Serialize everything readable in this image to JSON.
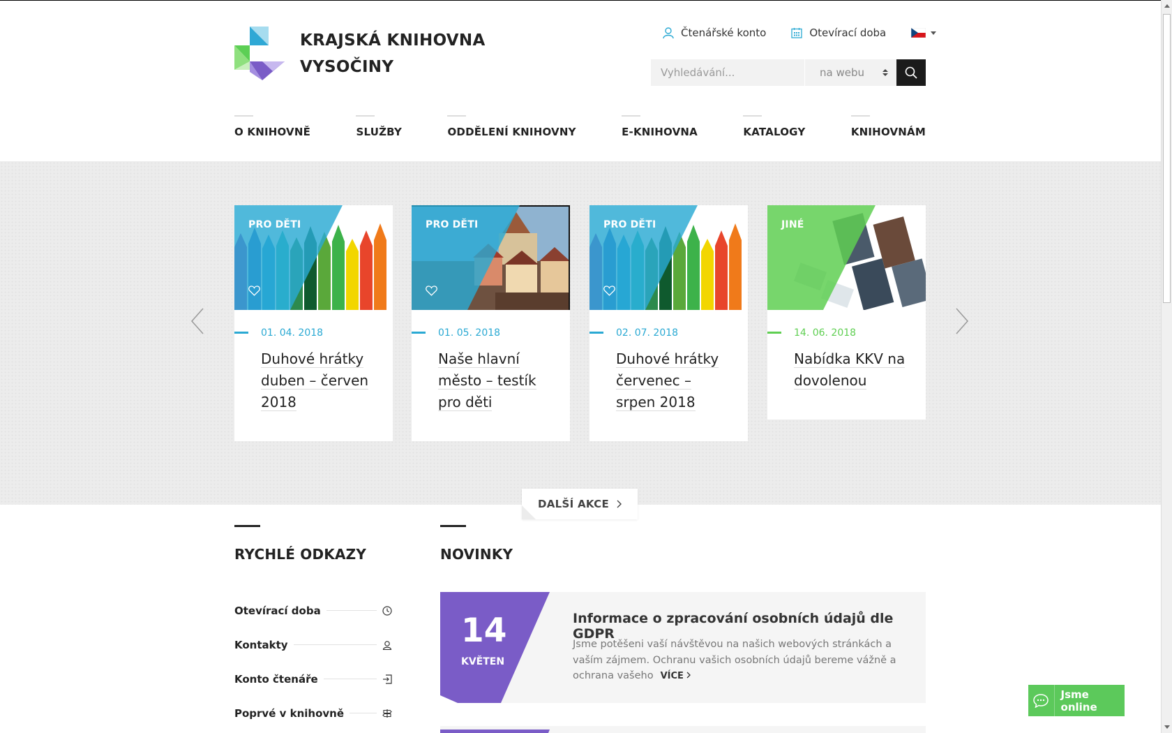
{
  "brand": {
    "line1": "KRAJSKÁ KNIHOVNA",
    "line2": "VYSOČINY"
  },
  "topnav": {
    "account": "Čtenářské konto",
    "hours": "Otevírací doba"
  },
  "search": {
    "placeholder": "Vyhledávání...",
    "scope": "na webu"
  },
  "mainnav": [
    "O KNIHOVNĚ",
    "SLUŽBY",
    "ODDĚLENÍ KNIHOVNY",
    "E-KNIHOVNA",
    "KATALOGY",
    "KNIHOVNÁM"
  ],
  "events": [
    {
      "category": "PRO DĚTI",
      "date": "01. 04. 2018",
      "title": "Duhové hrátky duben – červen 2018",
      "accent": "#2aa9d3"
    },
    {
      "category": "PRO DĚTI",
      "date": "01. 05. 2018",
      "title": "Naše hlavní město – testík pro děti",
      "accent": "#2aa9d3"
    },
    {
      "category": "PRO DĚTI",
      "date": "02. 07. 2018",
      "title": "Duhové hrátky červenec – srpen 2018",
      "accent": "#2aa9d3"
    },
    {
      "category": "JINÉ",
      "date": "14. 06. 2018",
      "title": "Nabídka KKV na dovolenou",
      "accent": "#5fcf52"
    }
  ],
  "more_events": "DALŠÍ AKCE",
  "quick_links": {
    "title": "RYCHLÉ ODKAZY",
    "items": [
      "Otevírací doba",
      "Kontakty",
      "Konto čtenáře",
      "Poprvé v knihovně"
    ]
  },
  "news": {
    "title": "NOVINKY",
    "items": [
      {
        "day": "14",
        "month": "KVĚTEN",
        "title": "Informace o zpracování osobních údajů dle GDPR",
        "text": "Jsme potěšeni vaší návštěvou na našich webových stránkách a vaším zájmem. Ochranu vašich osobních údajů bereme vážně a ochrana vašeho",
        "more": "VÍCE"
      }
    ]
  },
  "chat": "Jsme online",
  "colors": {
    "blue": "#2aa9d3",
    "green": "#5fcf52",
    "purple": "#7a5cc7",
    "dark": "#1b1b1b"
  }
}
